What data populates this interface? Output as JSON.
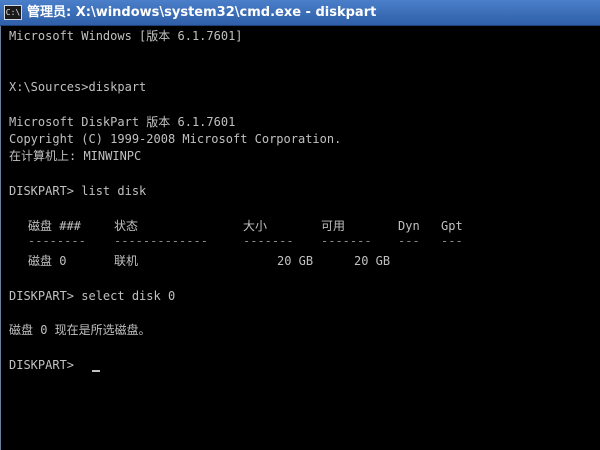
{
  "window": {
    "icon_label": "C:\\",
    "title": "管理员: X:\\windows\\system32\\cmd.exe - diskpart"
  },
  "console": {
    "line_winver": "Microsoft Windows [版本 6.1.7601]",
    "line_prompt_cmd": "X:\\Sources>diskpart",
    "line_dp_version": "Microsoft DiskPart 版本 6.1.7601",
    "line_copyright": "Copyright (C) 1999-2008 Microsoft Corporation.",
    "line_computer": "在计算机上: MINWINPC",
    "line_list_cmd": "DISKPART> list disk",
    "line_select_cmd": "DISKPART> select disk 0",
    "line_selected_msg": "磁盘 0 现在是所选磁盘。",
    "line_final_prompt": "DISKPART>"
  },
  "disk_table": {
    "headers": [
      "磁盘 ###",
      "状态",
      "大小",
      "可用",
      "Dyn",
      "Gpt"
    ],
    "dashes": [
      "--------",
      "-------------",
      "-------",
      "-------",
      "---",
      "---"
    ],
    "rows": [
      [
        "磁盘 0",
        "联机",
        "20 GB",
        "20 GB",
        "",
        ""
      ]
    ]
  }
}
